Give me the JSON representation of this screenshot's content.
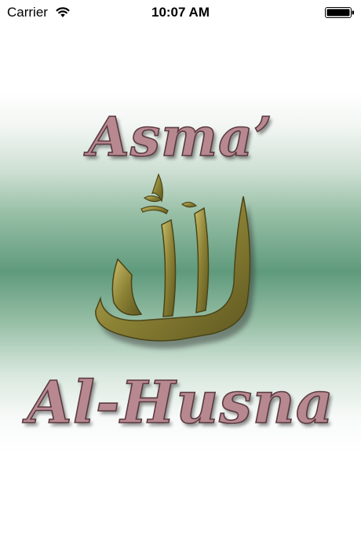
{
  "status_bar": {
    "carrier": "Carrier",
    "time": "10:07 AM",
    "wifi_icon": "wifi-icon",
    "battery_icon": "battery-icon"
  },
  "splash": {
    "title_top": "Asma’",
    "title_bottom": "Al-Husna",
    "calligraphy_icon": "allah-calligraphy-logo",
    "colors": {
      "title_fill": "#b88890",
      "title_outline": "#5a3a40",
      "calligraphy_gold": "#8c8235",
      "band_green": "#5f9a7c"
    }
  }
}
